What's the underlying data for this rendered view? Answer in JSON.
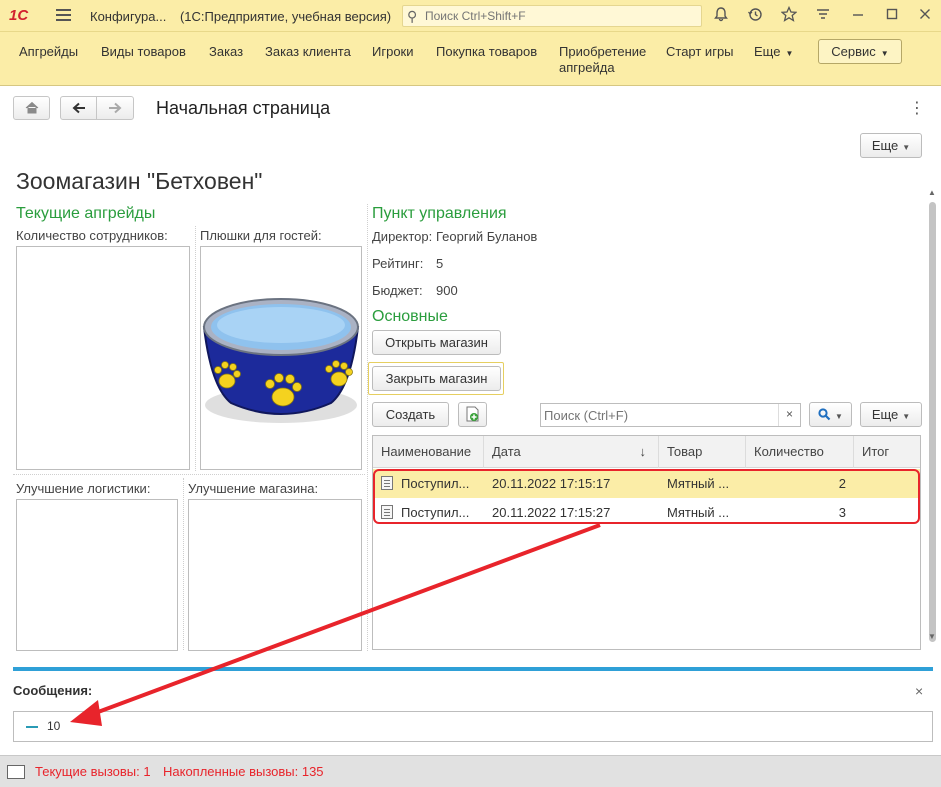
{
  "titlebar": {
    "logo": "1С",
    "title_short": "Конфигура...",
    "title_mode": "(1С:Предприятие, учебная версия)",
    "search_placeholder": "Поиск Ctrl+Shift+F",
    "icons": [
      "bell-icon",
      "history-icon",
      "star-icon",
      "settings-icon",
      "minimize-icon",
      "maximize-icon",
      "close-icon"
    ]
  },
  "sections": {
    "items": [
      "Апгрейды",
      "Виды товаров",
      "Заказ",
      "Заказ клиента",
      "Игроки",
      "Покупка товаров",
      "Приобретение апгрейда",
      "Старт игры"
    ],
    "more": "Еще",
    "service": "Сервис"
  },
  "page": {
    "title": "Начальная страница",
    "more": "Еще"
  },
  "store": {
    "title": "Зоомагазин \"Бетховен\"",
    "upgrades_title": "Текущие апгрейды",
    "labels": {
      "employees": "Количество сотрудников:",
      "goodies": "Плюшки для гостей:",
      "logistics": "Улучшение логистики:",
      "shop": "Улучшение магазина:"
    },
    "control": {
      "title": "Пункт управления",
      "director_label": "Директор:",
      "director": "Георгий Буланов",
      "rating_label": "Рейтинг:",
      "rating": "5",
      "budget_label": "Бюджет:",
      "budget": "900"
    },
    "main": {
      "title": "Основные",
      "open": "Открыть магазин",
      "close": "Закрыть магазин"
    }
  },
  "list": {
    "create": "Создать",
    "search_placeholder": "Поиск (Ctrl+F)",
    "clear": "×",
    "more": "Еще",
    "columns": [
      "Наименование",
      "Дата",
      "Товар",
      "Количество",
      "Итог"
    ],
    "sort_indicator": "↓",
    "rows": [
      {
        "name": "Поступил...",
        "date": "20.11.2022 17:15:17",
        "product": "Мятный ...",
        "qty": "2",
        "total": ""
      },
      {
        "name": "Поступил...",
        "date": "20.11.2022 17:15:27",
        "product": "Мятный ...",
        "qty": "3",
        "total": ""
      }
    ]
  },
  "messages": {
    "title": "Сообщения:",
    "close": "×",
    "items": [
      "10"
    ]
  },
  "status": {
    "current_calls": "Текущие вызовы: 1",
    "accumulated_calls": "Накопленные вызовы: 135"
  },
  "colors": {
    "accent_yellow": "#fbeda7",
    "green_heading": "#2a9d3d",
    "highlight_red": "#e8242b",
    "message_bar": "#2fa0d7"
  }
}
